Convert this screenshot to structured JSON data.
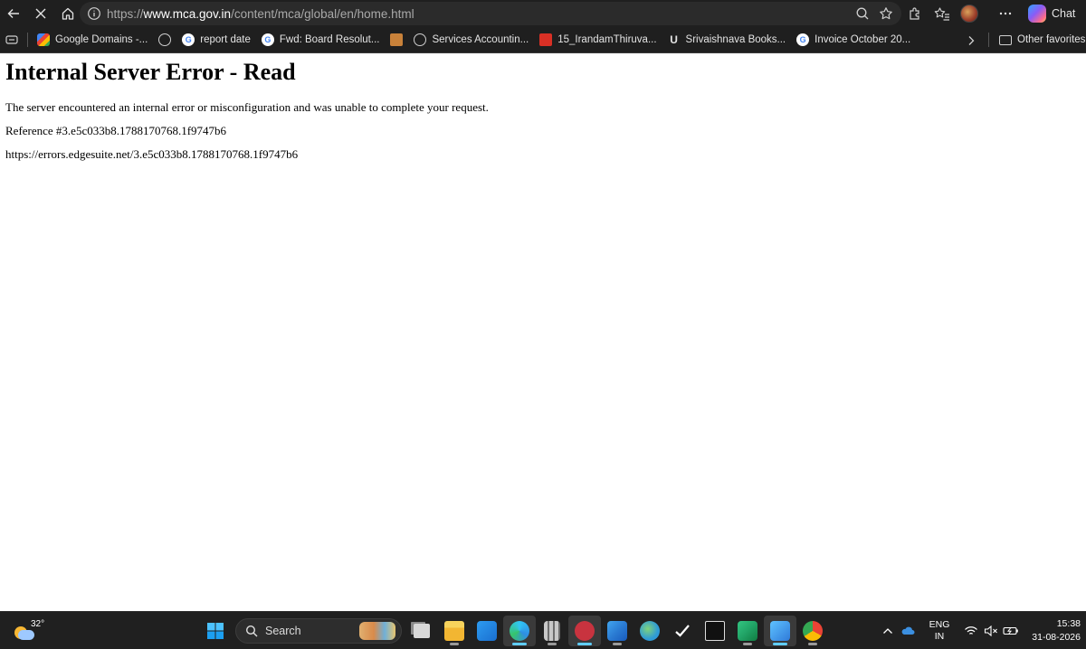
{
  "browser": {
    "url_scheme": "https://",
    "url_host": "www.mca.gov.in",
    "url_path": "/content/mca/global/en/home.html",
    "chat_label": "Chat"
  },
  "bookmarks": [
    {
      "label": "Google Domains -...",
      "icon": "google-domains-icon"
    },
    {
      "label": "",
      "icon": "globe-icon"
    },
    {
      "label": "report date",
      "icon": "google-icon"
    },
    {
      "label": "Fwd: Board Resolut...",
      "icon": "google-icon"
    },
    {
      "label": "",
      "icon": "emblem-icon"
    },
    {
      "label": "Services Accountin...",
      "icon": "globe-icon"
    },
    {
      "label": "15_IrandamThiruva...",
      "icon": "pdf-icon"
    },
    {
      "label": "Srivaishnava Books...",
      "icon": "u-icon"
    },
    {
      "label": "Invoice October 20...",
      "icon": "google-icon"
    }
  ],
  "other_favorites": "Other favorites",
  "page": {
    "heading": "Internal Server Error - Read",
    "message": "The server encountered an internal error or misconfiguration and was unable to complete your request.",
    "reference": "Reference #3.e5c033b8.1788170768.1f9747b6",
    "error_url": "https://errors.edgesuite.net/3.e5c033b8.1788170768.1f9747b6"
  },
  "taskbar": {
    "weather_temp": "32°",
    "search_label": "Search",
    "lang_top": "ENG",
    "lang_bottom": "IN",
    "time": "15:38",
    "date": "31-08-2026"
  },
  "colors": {
    "chrome_bg": "#1f1f1f",
    "address_bg": "#2b2b2b",
    "taskbar_bg": "#202020",
    "active_indicator": "#60cdff"
  }
}
